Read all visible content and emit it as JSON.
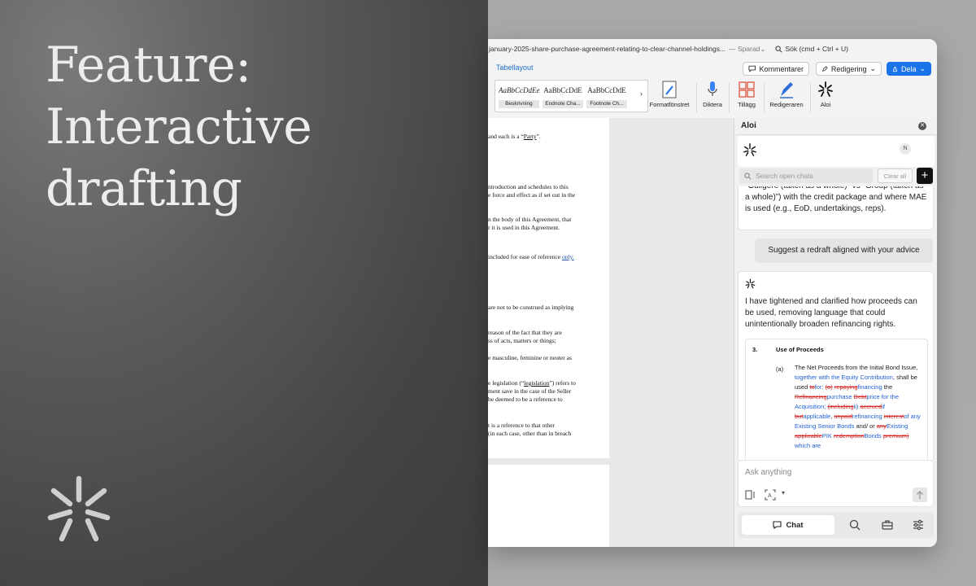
{
  "hero": {
    "title_lines": [
      "Feature:",
      "Interactive",
      "drafting"
    ]
  },
  "titlebar": {
    "filename": "january-2025-share-purchase-agreement-relating-to-clear-channel-holdings...",
    "save_status": "— Sparad",
    "search": "Sök (cmd + Ctrl + U)"
  },
  "ribbon": {
    "active_tab": "Tabellayout",
    "comments": "Kommentarer",
    "editing": "Redigering",
    "share": "Dela",
    "styles": [
      {
        "sample": "AaBbCcDdEe",
        "label": "Beskrivning"
      },
      {
        "sample": "AaBbCcDdE",
        "label": "Endnote Cha..."
      },
      {
        "sample": "AaBbCcDdE",
        "label": "Footnote Ch..."
      }
    ],
    "tools": {
      "format_pane": "Formatfönstret",
      "dictate": "Diktera",
      "addins": "Tillägg",
      "editor": "Redigeraren",
      "aloi": "Aloi"
    }
  },
  "document": {
    "l1a": "and each is a “",
    "l1b": "Party",
    "l1c": "”.",
    "l2": "ntroduction and schedules to this",
    "l3": "e force and effect as if set out in the",
    "l4": "n the body of this Agreement, that",
    "l5": "r it is used in this Agreement.",
    "l6a": "included for ease of reference ",
    "l6b": "only.",
    "l7": "are not to be construed as implying",
    "l8": " reason of the fact that they are",
    "l9": "ss of acts, matters or things;",
    "l10": "e masculine, feminine or neuter as",
    "l11a": "e legislation (“",
    "l11b": "legislation",
    "l11c": "”) refers to",
    "l12": "ment save in the case of the Seller",
    "l13": " be deemed to be a reference to",
    "l14": "t is a reference to that other",
    "l15": "(in each case, other than in breach"
  },
  "aloi": {
    "title": "Aloi",
    "avatar_initial": "N",
    "search_placeholder": "Search open chats",
    "clear_all": "Clear all",
    "new_chat": "+",
    "previous_message": "“Guligere (taken as a whole)” vs “Group (taken as a whole)”) with the credit package and where MAE is used (e.g., EoD, undertakings, reps).",
    "user_message": "Suggest a redraft aligned with your advice",
    "assistant_message": "I have tightened and clarified how proceeds can be used, removing language that could unintentionally broaden refinancing rights.",
    "redline": {
      "clause_number": "3.",
      "clause_title": "Use of Proceeds",
      "sub_number": "(a)",
      "segments": [
        {
          "t": "The Net Proceeds from the Initial Bond Issue, ",
          "k": "n"
        },
        {
          "t": "together with the Equity Contribution",
          "k": "i"
        },
        {
          "t": ", shall be used ",
          "k": "n"
        },
        {
          "t": "to",
          "k": "d"
        },
        {
          "t": "for: ",
          "k": "i"
        },
        {
          "t": "(a)",
          "k": "d"
        },
        {
          "t": " ",
          "k": "n"
        },
        {
          "t": "repaying",
          "k": "d"
        },
        {
          "t": "financing",
          "k": "i"
        },
        {
          "t": " the ",
          "k": "n"
        },
        {
          "t": "Refinancing",
          "k": "d"
        },
        {
          "t": "purchase",
          "k": "i"
        },
        {
          "t": " ",
          "k": "n"
        },
        {
          "t": "Debt",
          "k": "d"
        },
        {
          "t": "price for the Acquisition;",
          "k": "i"
        },
        {
          "t": " ",
          "k": "n"
        },
        {
          "t": "(including",
          "k": "d"
        },
        {
          "t": "ii)",
          "k": "i"
        },
        {
          "t": " ",
          "k": "n"
        },
        {
          "t": "accrued",
          "k": "d"
        },
        {
          "t": "if",
          "k": "i"
        },
        {
          "t": " ",
          "k": "n"
        },
        {
          "t": "but",
          "k": "d"
        },
        {
          "t": "applicable",
          "k": "i"
        },
        {
          "t": ", ",
          "k": "n"
        },
        {
          "t": "unpaid",
          "k": "d"
        },
        {
          "t": "refinancing",
          "k": "i"
        },
        {
          "t": " ",
          "k": "n"
        },
        {
          "t": "interest",
          "k": "d"
        },
        {
          "t": "of any Existing Senior Bonds",
          "k": "i"
        },
        {
          "t": " and/ or ",
          "k": "n"
        },
        {
          "t": "any",
          "k": "d"
        },
        {
          "t": "Existing",
          "k": "i"
        },
        {
          "t": " ",
          "k": "n"
        },
        {
          "t": "applicable",
          "k": "d"
        },
        {
          "t": "PIK",
          "k": "i"
        },
        {
          "t": " ",
          "k": "n"
        },
        {
          "t": "redemption",
          "k": "d"
        },
        {
          "t": "Bonds",
          "k": "i"
        },
        {
          "t": " ",
          "k": "n"
        },
        {
          "t": "premium)",
          "k": "d"
        },
        {
          "t": " which are",
          "k": "i"
        }
      ]
    },
    "composer_placeholder": "Ask anything",
    "nav_chat": "Chat"
  },
  "colors": {
    "accent_blue": "#1a73e8",
    "insert_blue": "#1f5fd6",
    "delete_red": "#d62b2b"
  }
}
